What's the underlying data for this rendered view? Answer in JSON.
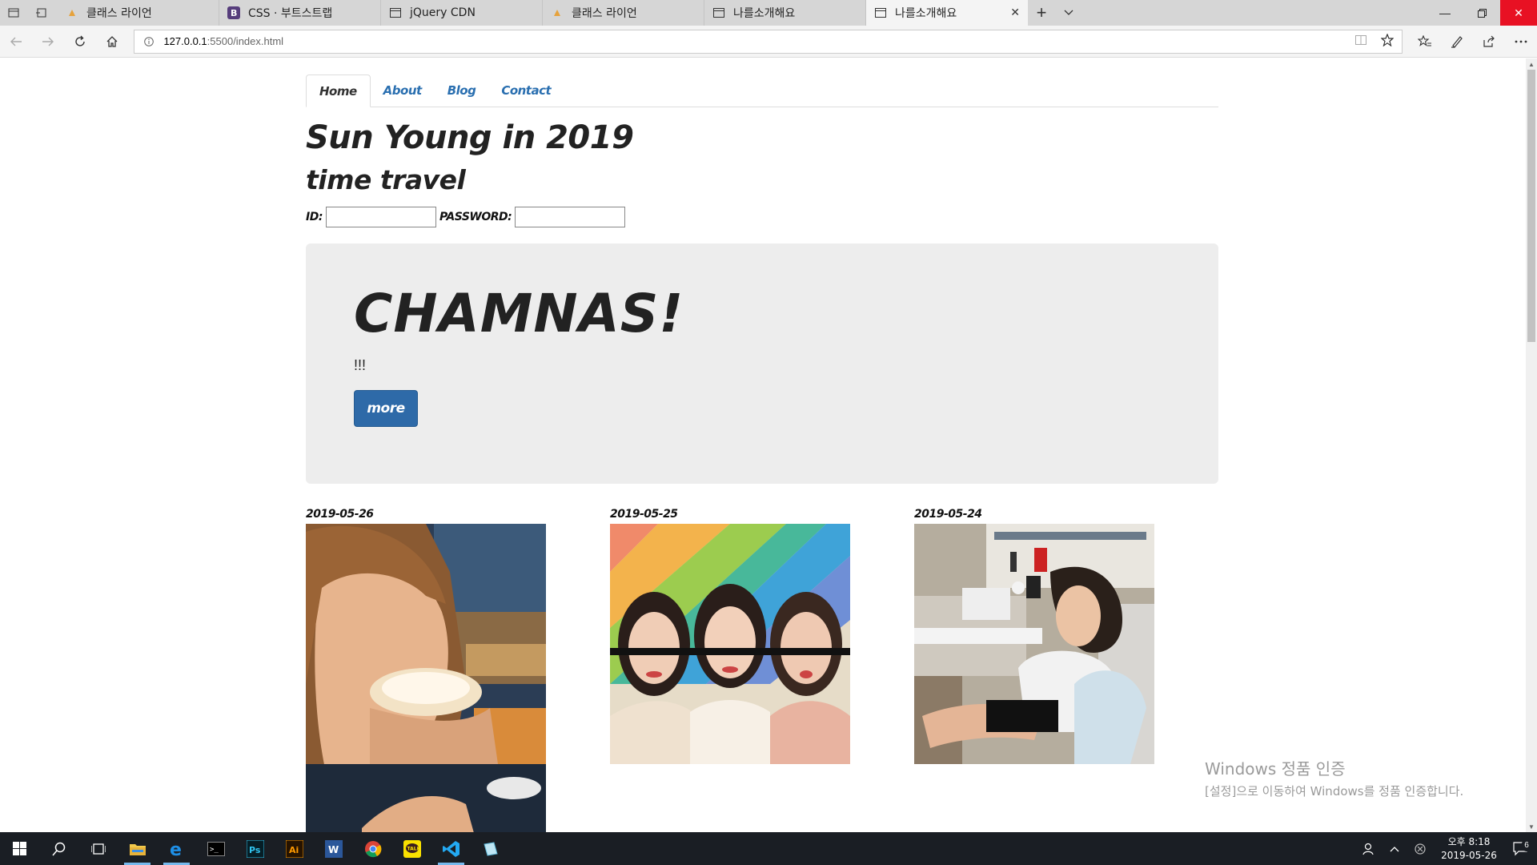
{
  "browser": {
    "tabs": [
      {
        "title": "클래스 라이언",
        "icon": "class-lion-favicon"
      },
      {
        "title": "CSS · 부트스트랩",
        "icon": "bootstrap-favicon"
      },
      {
        "title": "jQuery CDN",
        "icon": "page-icon"
      },
      {
        "title": "클래스 라이언",
        "icon": "class-lion-favicon"
      },
      {
        "title": "나를소개해요",
        "icon": "page-icon"
      },
      {
        "title": "나를소개해요",
        "icon": "page-icon"
      }
    ],
    "url_host": "127.0.0.1",
    "url_path": ":5500/index.html"
  },
  "page": {
    "nav": [
      "Home",
      "About",
      "Blog",
      "Contact"
    ],
    "title": "Sun Young in 2019",
    "subtitle": "time travel",
    "login": {
      "id_label": "ID:",
      "password_label": "PASSWORD:"
    },
    "jumbotron": {
      "heading": "CHAMNAS!",
      "text": "!!!",
      "button": "more"
    },
    "gallery": [
      {
        "date": "2019-05-26"
      },
      {
        "date": "2019-05-25"
      },
      {
        "date": "2019-05-24"
      }
    ]
  },
  "watermark": {
    "line1": "Windows 정품 인증",
    "line2": "[설정]으로 이동하여 Windows를 정품 인증합니다."
  },
  "taskbar": {
    "time": "오후 8:18",
    "date": "2019-05-26",
    "notifications": "6"
  },
  "colors": {
    "link": "#2a6fb0",
    "button": "#2e6aa8",
    "jumbotron": "#ededed",
    "taskbar": "#1a1e24",
    "close": "#e81123"
  }
}
